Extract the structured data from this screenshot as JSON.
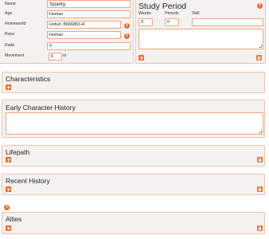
{
  "identity": {
    "fields": [
      {
        "label": "Name",
        "value": "Sparky"
      },
      {
        "label": "Age",
        "value": "Human"
      },
      {
        "label": "Homeworld",
        "value": "Hofud: B666853-A"
      },
      {
        "label": "Race",
        "value": "Human"
      },
      {
        "label": "Rads",
        "value": "0"
      },
      {
        "label": "Movement",
        "value": "6",
        "unit": "m"
      }
    ]
  },
  "study_period": {
    "title": "Study Period",
    "weeks_label": "Weeks",
    "weeks_value": "0",
    "periods_label": "Periods",
    "periods_value": "0",
    "skill_label": "Skill",
    "skill_value": ""
  },
  "sections": {
    "characteristics": "Characteristics",
    "early_history": "Early Character History",
    "lifepath": "Lifepath",
    "recent_history": "Recent History",
    "allies": "Allies"
  },
  "icons": {
    "add": "plus-icon",
    "lock": "lock-icon",
    "info": "info-icon"
  },
  "colors": {
    "accent": "#ee6f2d",
    "border": "#f0a67e",
    "panel": "#f3f2f1"
  }
}
